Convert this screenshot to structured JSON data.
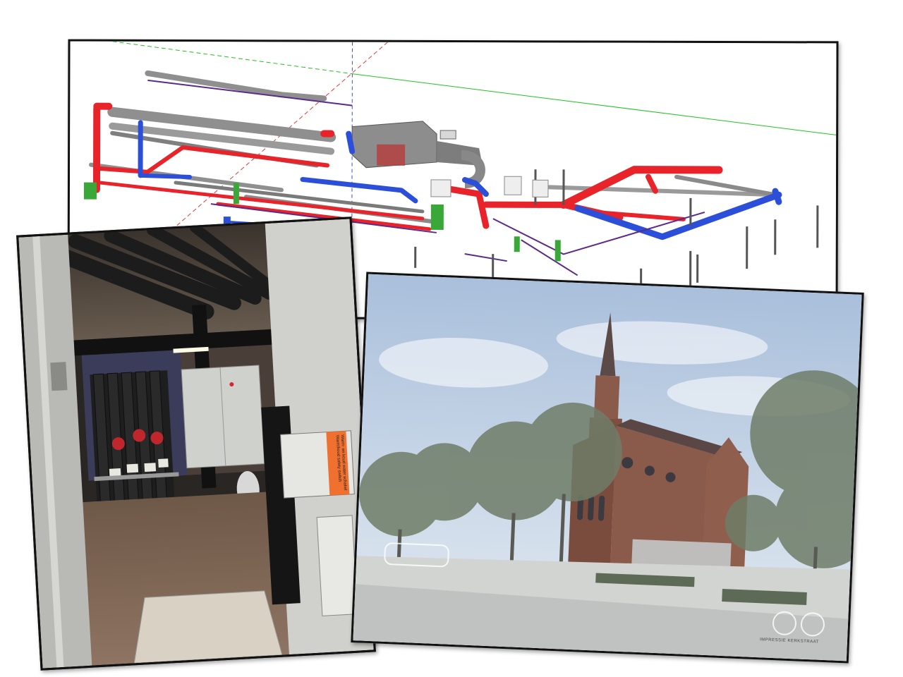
{
  "collage": {
    "cad_model": {
      "label": ""
    },
    "boiler_room_photo": {
      "sticker_lines": [
        "Warm- en koud water schakel",
        "Warm/koud safety switch"
      ]
    },
    "church_render": {
      "caption": "IMPRESSIE KERKSTRAAT"
    }
  },
  "colors": {
    "supply_pipe": "#e8232a",
    "return_pipe": "#2b4fd8",
    "insulated_pipe": "#8f8f8f",
    "equipment_green": "#3aa838",
    "axis_green": "#22c322",
    "axis_red": "#e03a3a",
    "axis_blue": "#3a4ad8",
    "tree_green": "#6f7d68",
    "brick": "#8a5a4a",
    "sky": "#c9d6e6"
  }
}
